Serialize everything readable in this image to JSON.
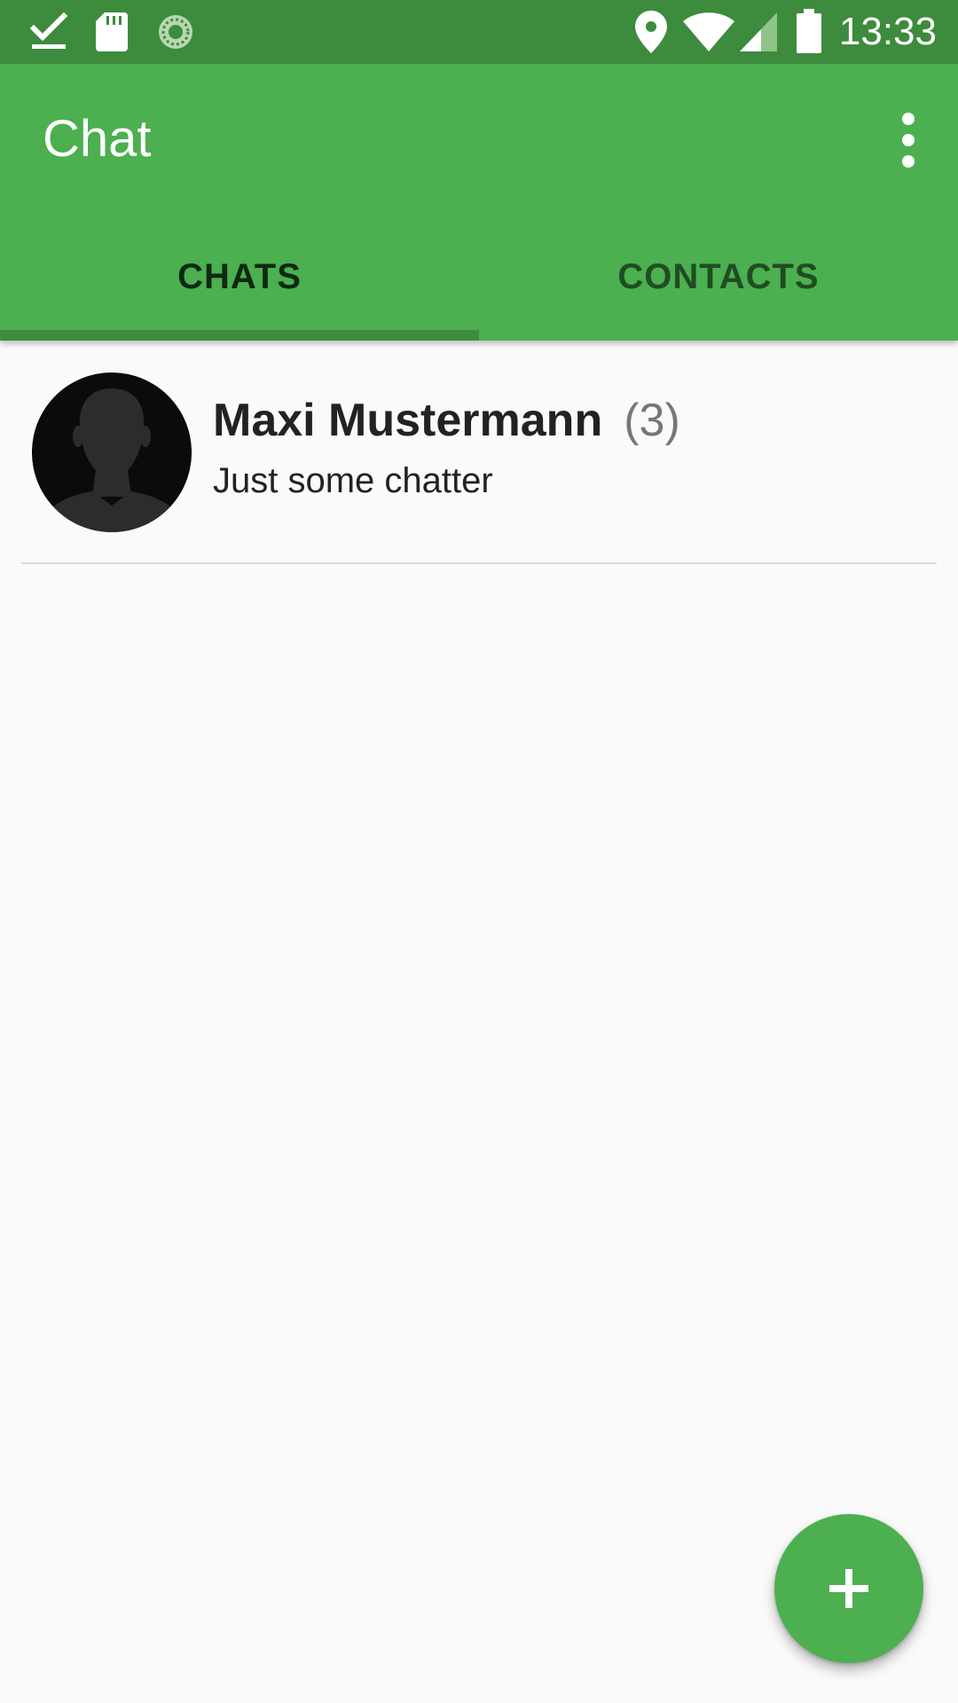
{
  "status_bar": {
    "time": "13:33",
    "left_icons": [
      "download-done-icon",
      "sd-card-icon",
      "sync-progress-icon"
    ],
    "right_icons": [
      "location-icon",
      "wifi-icon",
      "cell-signal-icon",
      "battery-icon"
    ]
  },
  "app_bar": {
    "title": "Chat",
    "overflow_icon": "more-vert-icon"
  },
  "tabs": [
    {
      "label": "CHATS",
      "selected": true
    },
    {
      "label": "CONTACTS",
      "selected": false
    }
  ],
  "chats": [
    {
      "name": "Maxi Mustermann",
      "count": "(3)",
      "preview": "Just some chatter",
      "avatar_icon": "person-silhouette-icon"
    }
  ],
  "fab": {
    "icon": "plus-icon"
  },
  "colors": {
    "primary": "#4CAF50",
    "primary_dark": "#3D8B3D",
    "background": "#FAFAFA",
    "text_primary": "#222222",
    "text_secondary": "#777777"
  }
}
